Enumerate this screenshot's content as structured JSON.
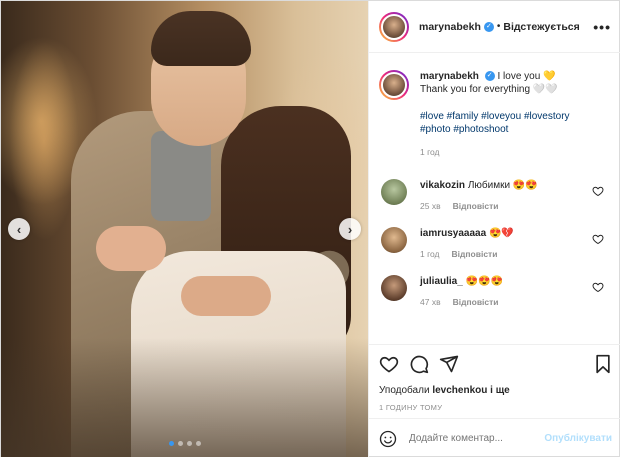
{
  "post": {
    "username": "marynabekh",
    "follow_status": "Відстежується",
    "separator": "•",
    "more": "•••",
    "verified": "✓"
  },
  "caption": {
    "username": "marynabekh",
    "text_line1": "I love you 💛",
    "text_line2": "Thank you for everything 🤍🤍",
    "hashtags_line1": "#love #family #loveyou #lovestory",
    "hashtags_line2": "#photo #photoshoot",
    "time": "1 год"
  },
  "comments": [
    {
      "username": "vikakozin",
      "text": "Любимки 😍😍",
      "time": "25 хв",
      "reply": "Відповісти"
    },
    {
      "username": "iamrusyaaaaa",
      "text": "😍💔",
      "time": "1 год",
      "reply": "Відповісти"
    },
    {
      "username": "juliaulia_",
      "text": "😍😍😍",
      "time": "47 хв",
      "reply": "Відповісти"
    }
  ],
  "actions": {
    "likes_prefix": "Уподобали ",
    "likes_user": "levchenkou",
    "likes_suffix": " і ще",
    "timestamp": "1 ГОДИНУ ТОМУ"
  },
  "composer": {
    "placeholder": "Додайте коментар...",
    "publish": "Опублікувати"
  },
  "carousel": {
    "prev": "‹",
    "next": "›",
    "slide_count": 4,
    "active_index": 0
  },
  "colors": {
    "accent": "#3897f0",
    "link": "#00376b",
    "muted": "#8e8e8e",
    "publish_disabled": "#b2dffc"
  }
}
